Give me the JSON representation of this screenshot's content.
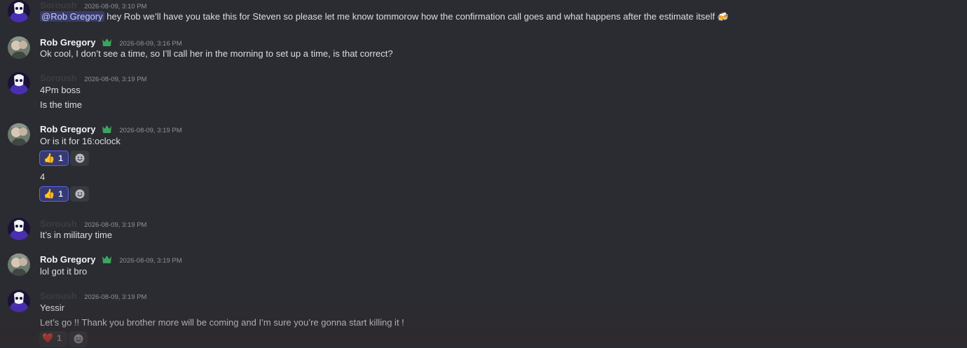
{
  "messages": [
    {
      "author": "Soroush",
      "time": "2026-08-09, 3:10 PM",
      "lines": [
        {
          "mention": "@Rob Gregory",
          "text": " hey Rob we’ll have you take this for Steven so please let me know tommorow how the confirmation call goes and what happens after the estimate itself",
          "emoji": "🍻"
        }
      ]
    },
    {
      "author": "Rob Gregory",
      "time": "2026-08-09, 3:16 PM",
      "lines": [
        "Ok cool, I don’t see a time, so I’ll call her in the morning to set up a time, is that correct?"
      ]
    },
    {
      "author": "Soroush",
      "time": "2026-08-09, 3:19 PM",
      "lines": [
        "4Pm boss",
        "Is the time"
      ]
    },
    {
      "author": "Rob Gregory",
      "time": "2026-08-09, 3:19 PM",
      "lines": [
        "Or is it for 16:oclock",
        "4"
      ],
      "reactions": [
        {
          "emoji": "👍",
          "count": "1"
        },
        {
          "emoji": "👍",
          "count": "1"
        }
      ]
    },
    {
      "author": "Soroush",
      "time": "2026-08-09, 3:19 PM",
      "lines": [
        "It’s in military time"
      ]
    },
    {
      "author": "Rob Gregory",
      "time": "2026-08-09, 3:19 PM",
      "lines": [
        "lol got it bro"
      ]
    },
    {
      "author": "Soroush",
      "time": "2026-08-09, 3:19 PM",
      "lines": [
        "Yessir",
        "Let’s go !! Thank you brother more will be coming and I’m sure you’re gonna start killing it !"
      ],
      "reactions": [
        {
          "emoji": "❤️",
          "count": "1"
        }
      ]
    }
  ],
  "colors": {
    "background": "#2b2c31",
    "mention_bg": "#3d4270",
    "reaction_border": "#5865f2",
    "soroush_avatar": "#4a2fb0",
    "badge_green": "#3ba55d"
  },
  "icons": [
    "add-reaction-icon",
    "soroush-avatar",
    "rob-gregory-avatar",
    "guild-badge-icon"
  ]
}
